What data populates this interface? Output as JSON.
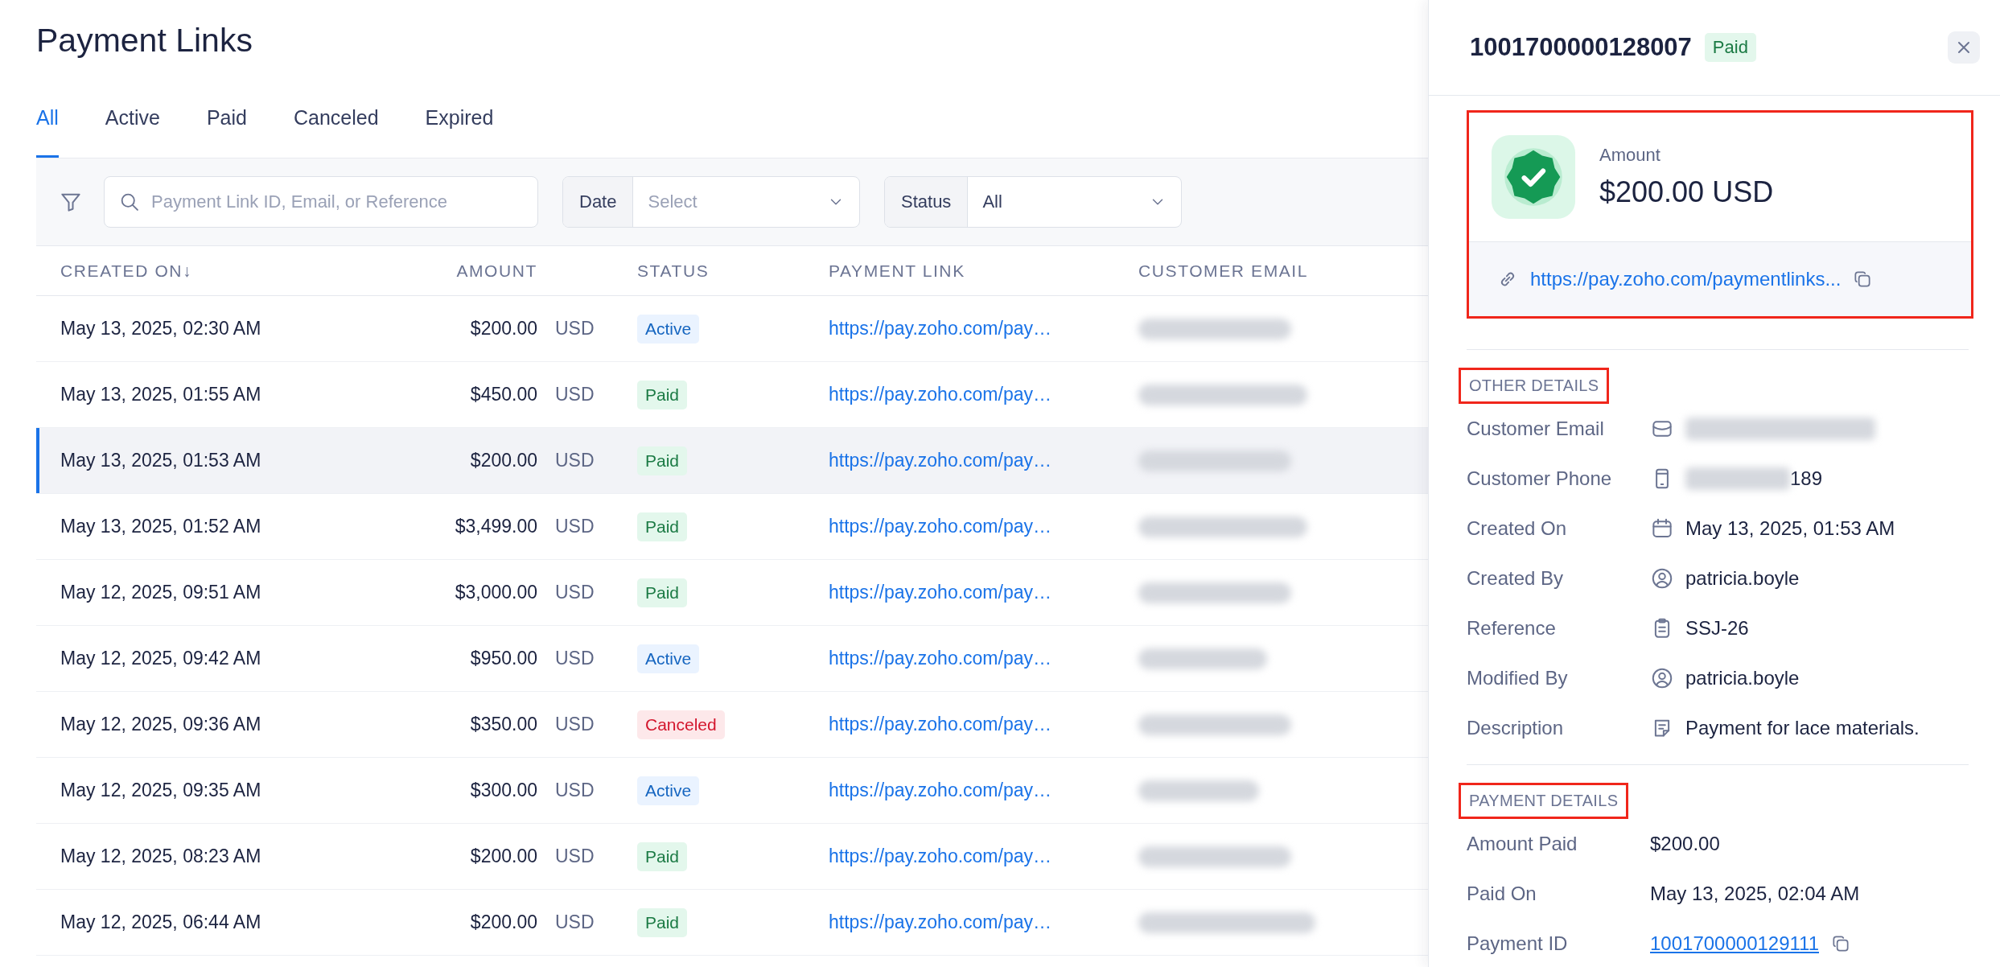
{
  "page": {
    "title": "Payment Links"
  },
  "tabs": [
    {
      "label": "All",
      "selected": true
    },
    {
      "label": "Active",
      "selected": false
    },
    {
      "label": "Paid",
      "selected": false
    },
    {
      "label": "Canceled",
      "selected": false
    },
    {
      "label": "Expired",
      "selected": false
    }
  ],
  "filters": {
    "search": {
      "placeholder": "Payment Link ID, Email, or Reference"
    },
    "date": {
      "label": "Date",
      "placeholder": "Select"
    },
    "status": {
      "label": "Status",
      "value": "All"
    }
  },
  "table": {
    "columns": [
      "CREATED ON↓",
      "AMOUNT",
      "STATUS",
      "PAYMENT LINK",
      "CUSTOMER EMAIL"
    ],
    "rows": [
      {
        "created_on": "May 13, 2025, 02:30 AM",
        "amount": "$200.00",
        "currency": "USD",
        "status": {
          "label": "Active",
          "kind": "active"
        },
        "link": "https://pay.zoho.com/pay…",
        "selected": false
      },
      {
        "created_on": "May 13, 2025, 01:55 AM",
        "amount": "$450.00",
        "currency": "USD",
        "status": {
          "label": "Paid",
          "kind": "paid"
        },
        "link": "https://pay.zoho.com/pay…",
        "selected": false
      },
      {
        "created_on": "May 13, 2025, 01:53 AM",
        "amount": "$200.00",
        "currency": "USD",
        "status": {
          "label": "Paid",
          "kind": "paid"
        },
        "link": "https://pay.zoho.com/pay…",
        "selected": true
      },
      {
        "created_on": "May 13, 2025, 01:52 AM",
        "amount": "$3,499.00",
        "currency": "USD",
        "status": {
          "label": "Paid",
          "kind": "paid"
        },
        "link": "https://pay.zoho.com/pay…",
        "selected": false
      },
      {
        "created_on": "May 12, 2025, 09:51 AM",
        "amount": "$3,000.00",
        "currency": "USD",
        "status": {
          "label": "Paid",
          "kind": "paid"
        },
        "link": "https://pay.zoho.com/pay…",
        "selected": false
      },
      {
        "created_on": "May 12, 2025, 09:42 AM",
        "amount": "$950.00",
        "currency": "USD",
        "status": {
          "label": "Active",
          "kind": "active"
        },
        "link": "https://pay.zoho.com/pay…",
        "selected": false
      },
      {
        "created_on": "May 12, 2025, 09:36 AM",
        "amount": "$350.00",
        "currency": "USD",
        "status": {
          "label": "Canceled",
          "kind": "canceled"
        },
        "link": "https://pay.zoho.com/pay…",
        "selected": false
      },
      {
        "created_on": "May 12, 2025, 09:35 AM",
        "amount": "$300.00",
        "currency": "USD",
        "status": {
          "label": "Active",
          "kind": "active"
        },
        "link": "https://pay.zoho.com/pay…",
        "selected": false
      },
      {
        "created_on": "May 12, 2025, 08:23 AM",
        "amount": "$200.00",
        "currency": "USD",
        "status": {
          "label": "Paid",
          "kind": "paid"
        },
        "link": "https://pay.zoho.com/pay…",
        "selected": false
      },
      {
        "created_on": "May 12, 2025, 06:44 AM",
        "amount": "$200.00",
        "currency": "USD",
        "status": {
          "label": "Paid",
          "kind": "paid"
        },
        "link": "https://pay.zoho.com/pay…",
        "selected": false
      }
    ]
  },
  "detail": {
    "id": "1001700000128007",
    "status": {
      "label": "Paid",
      "kind": "paid"
    },
    "summary": {
      "highlighted": true,
      "amount_label": "Amount",
      "amount": "$200.00 USD",
      "link": "https://pay.zoho.com/paymentlinks..."
    },
    "sections": [
      {
        "heading": "OTHER DETAILS",
        "highlighted": true,
        "fields": [
          {
            "label": "Customer Email",
            "redacted": true
          },
          {
            "label": "Customer Phone",
            "redacted": true,
            "value": "189"
          },
          {
            "label": "Created On",
            "value": "May 13, 2025, 01:53 AM"
          },
          {
            "label": "Created By",
            "value": "patricia.boyle"
          },
          {
            "label": "Reference",
            "value": "SSJ-26"
          },
          {
            "label": "Modified By",
            "value": "patricia.boyle"
          },
          {
            "label": "Description",
            "value": "Payment for lace materials."
          }
        ]
      },
      {
        "heading": "PAYMENT DETAILS",
        "highlighted": true,
        "fields": [
          {
            "label": "Amount Paid",
            "value": "$200.00"
          },
          {
            "label": "Paid On",
            "value": "May 13, 2025, 02:04 AM"
          },
          {
            "label": "Payment ID",
            "value": "1001700000129111",
            "kind": "link"
          }
        ]
      }
    ]
  }
}
